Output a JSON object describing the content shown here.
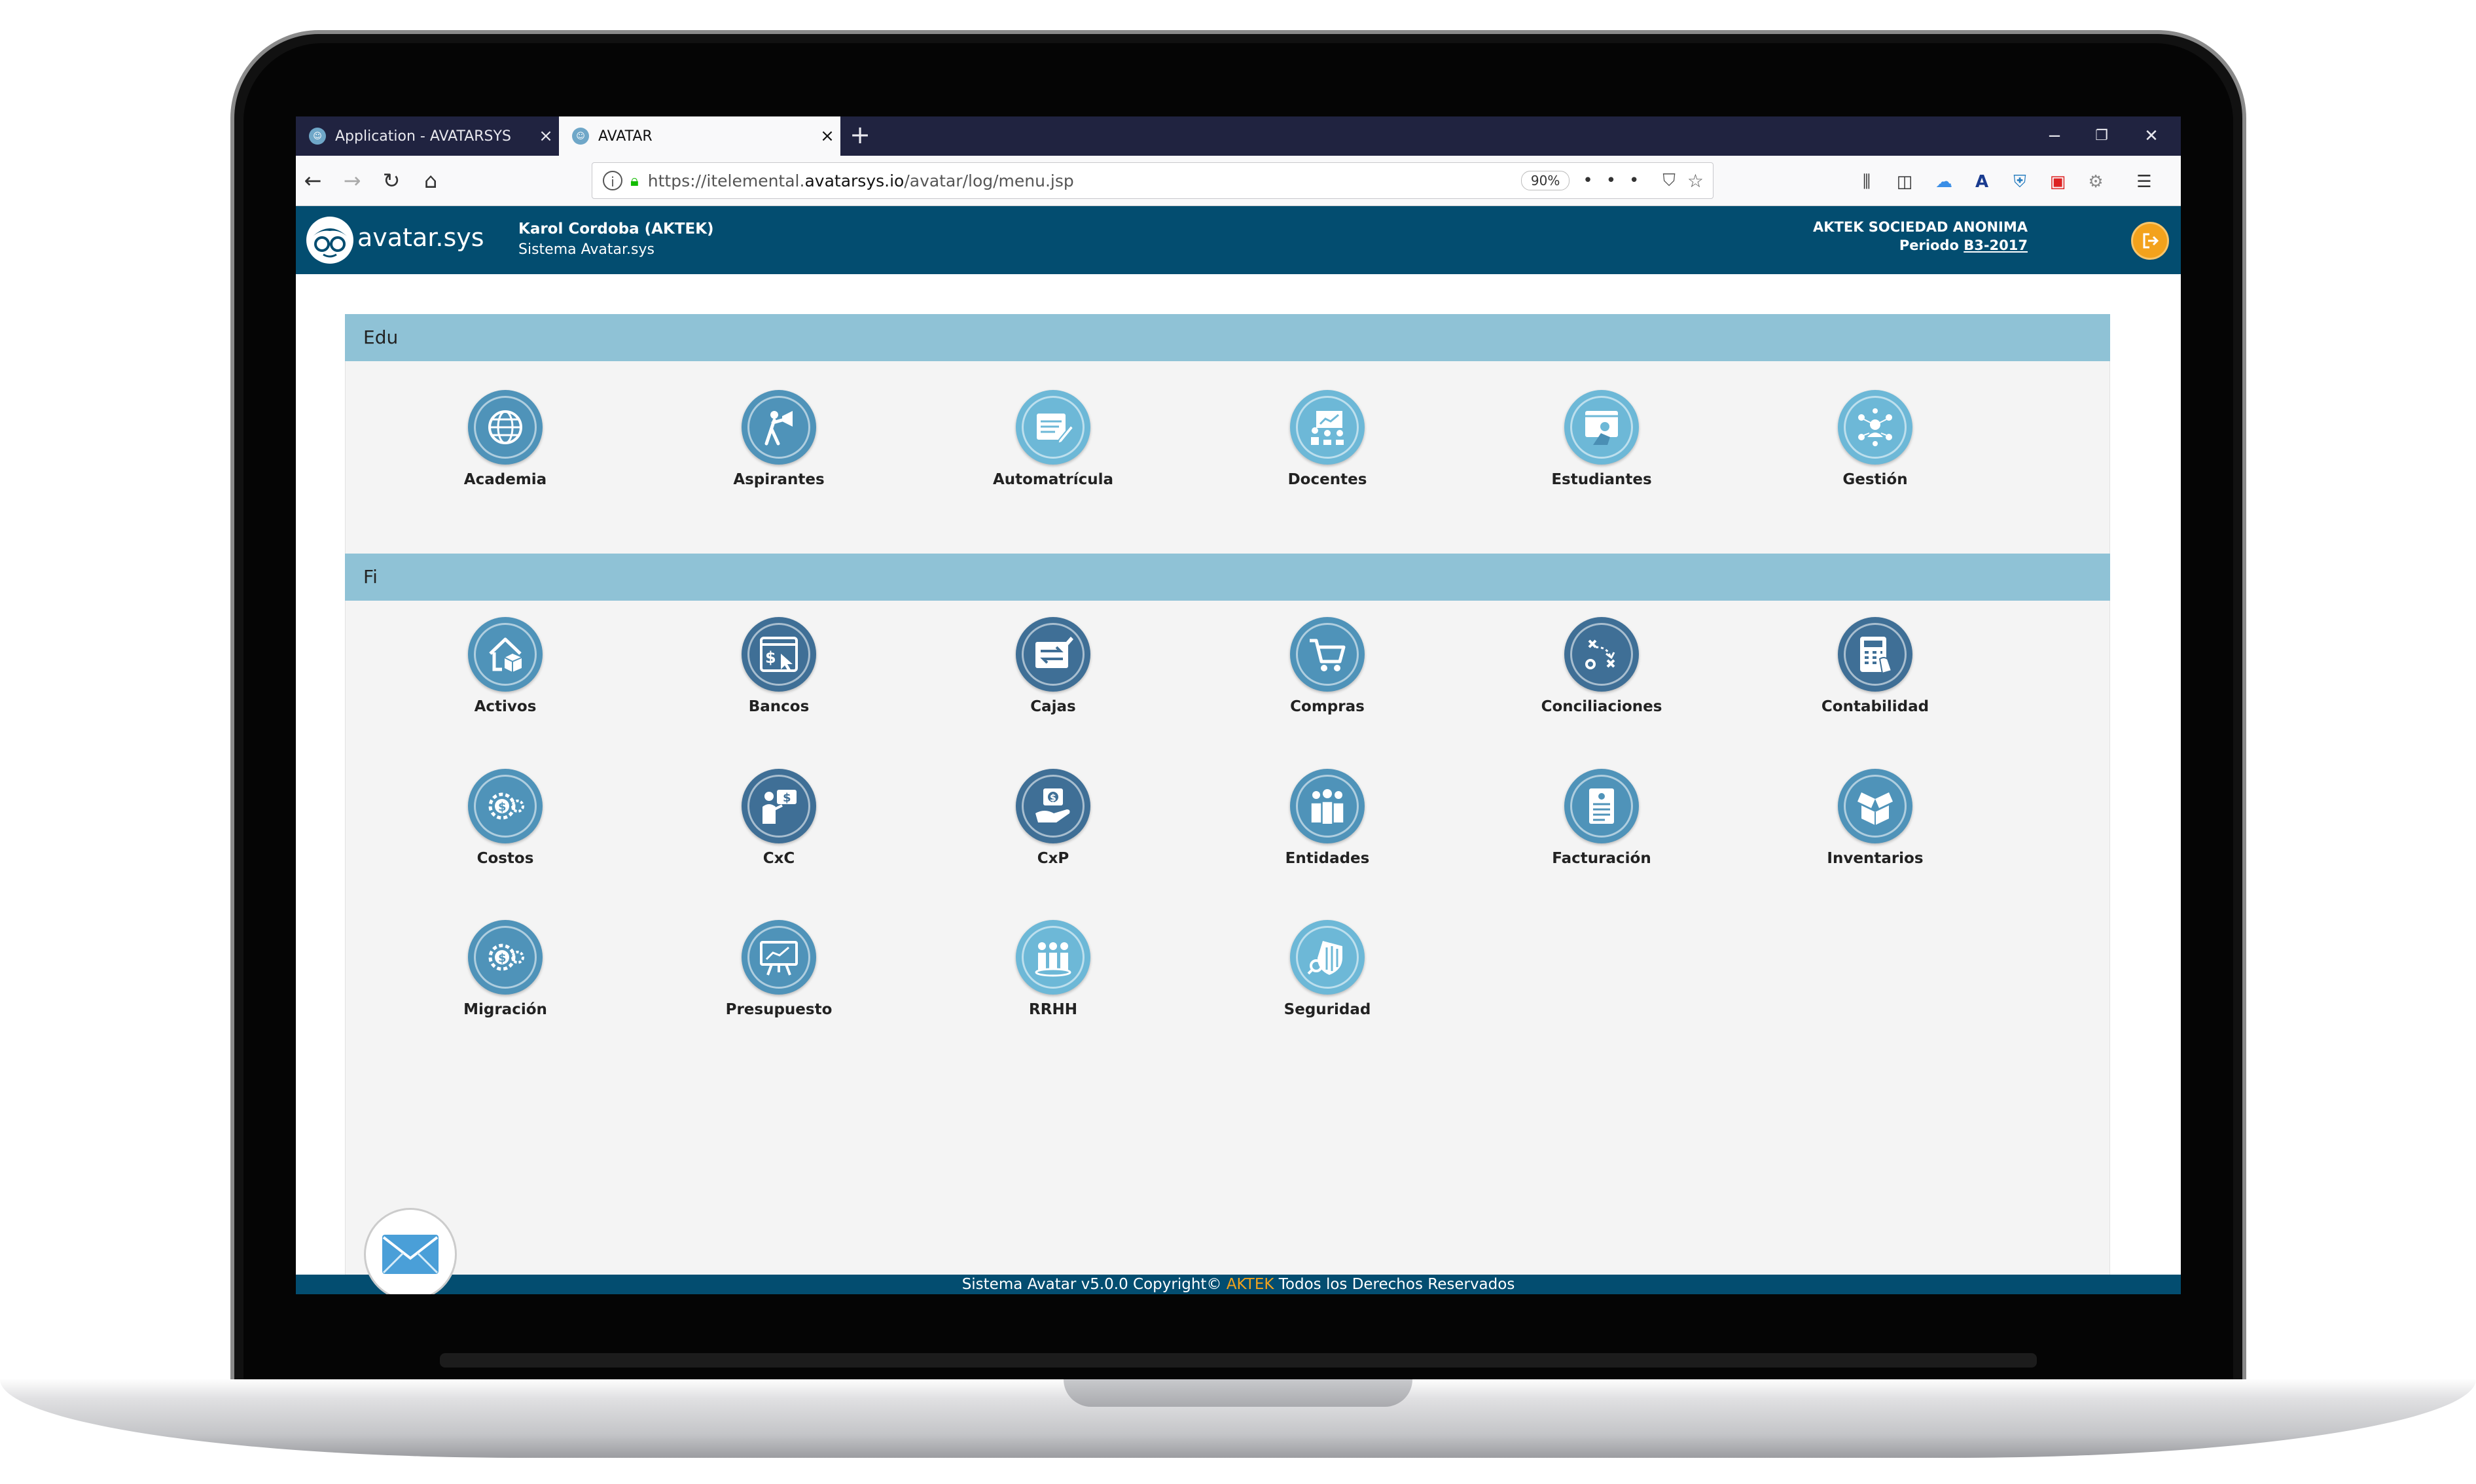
{
  "browser": {
    "tabs": [
      {
        "title": "Application - AVATARSYS",
        "active": false
      },
      {
        "title": "AVATAR",
        "active": true
      }
    ],
    "url_prefix": "https://itelemental.",
    "url_domain": "avatarsys.io",
    "url_path": "/avatar/log/menu.jsp",
    "zoom": "90%"
  },
  "header": {
    "logo_text": "avatar.sys",
    "user_name": "Karol Cordoba (AKTEK)",
    "system_name": "Sistema Avatar.sys",
    "company": "AKTEK SOCIEDAD ANONIMA",
    "period_label": "Periodo",
    "period_value": "B3-2017"
  },
  "sections": [
    {
      "title": "Edu",
      "modules": [
        {
          "label": "Academia",
          "icon": "globe-network-icon",
          "color": "#4f93b9"
        },
        {
          "label": "Aspirantes",
          "icon": "person-megaphone-icon",
          "color": "#4f93b9"
        },
        {
          "label": "Automatrícula",
          "icon": "form-edit-icon",
          "color": "#6db8d7"
        },
        {
          "label": "Docentes",
          "icon": "teacher-board-icon",
          "color": "#6db8d7"
        },
        {
          "label": "Estudiantes",
          "icon": "student-screen-icon",
          "color": "#6db8d7"
        },
        {
          "label": "Gestión",
          "icon": "people-network-icon",
          "color": "#6db8d7"
        }
      ]
    },
    {
      "title": "Fi",
      "modules": [
        {
          "label": "Activos",
          "icon": "house-box-icon",
          "color": "#4f93b9"
        },
        {
          "label": "Bancos",
          "icon": "dollar-window-icon",
          "color": "#3f6f96"
        },
        {
          "label": "Cajas",
          "icon": "cash-exchange-icon",
          "color": "#3f6f96"
        },
        {
          "label": "Compras",
          "icon": "shopping-cart-icon",
          "color": "#4f93b9"
        },
        {
          "label": "Conciliaciones",
          "icon": "strategy-icon",
          "color": "#3f6f96"
        },
        {
          "label": "Contabilidad",
          "icon": "calculator-icon",
          "color": "#3f6f96"
        },
        {
          "label": "Costos",
          "icon": "dollar-gear-icon",
          "color": "#4f93b9"
        },
        {
          "label": "CxC",
          "icon": "person-money-icon",
          "color": "#3f6f96"
        },
        {
          "label": "CxP",
          "icon": "hand-money-icon",
          "color": "#3f6f96"
        },
        {
          "label": "Entidades",
          "icon": "group-icon",
          "color": "#4f93b9"
        },
        {
          "label": "Facturación",
          "icon": "invoice-icon",
          "color": "#4f93b9"
        },
        {
          "label": "Inventarios",
          "icon": "boxes-icon",
          "color": "#4f93b9"
        },
        {
          "label": "Migración",
          "icon": "dollar-gear-icon",
          "color": "#4f93b9"
        },
        {
          "label": "Presupuesto",
          "icon": "presentation-chart-icon",
          "color": "#4f93b9"
        },
        {
          "label": "RRHH",
          "icon": "team-icon",
          "color": "#6db8d7"
        },
        {
          "label": "Seguridad",
          "icon": "shield-icon",
          "color": "#6db8d7"
        }
      ]
    }
  ],
  "footer": {
    "prefix": "Sistema Avatar v5.0.0 Copyright©",
    "brand": "AKTEK",
    "suffix": "Todos los Derechos Reservados"
  }
}
